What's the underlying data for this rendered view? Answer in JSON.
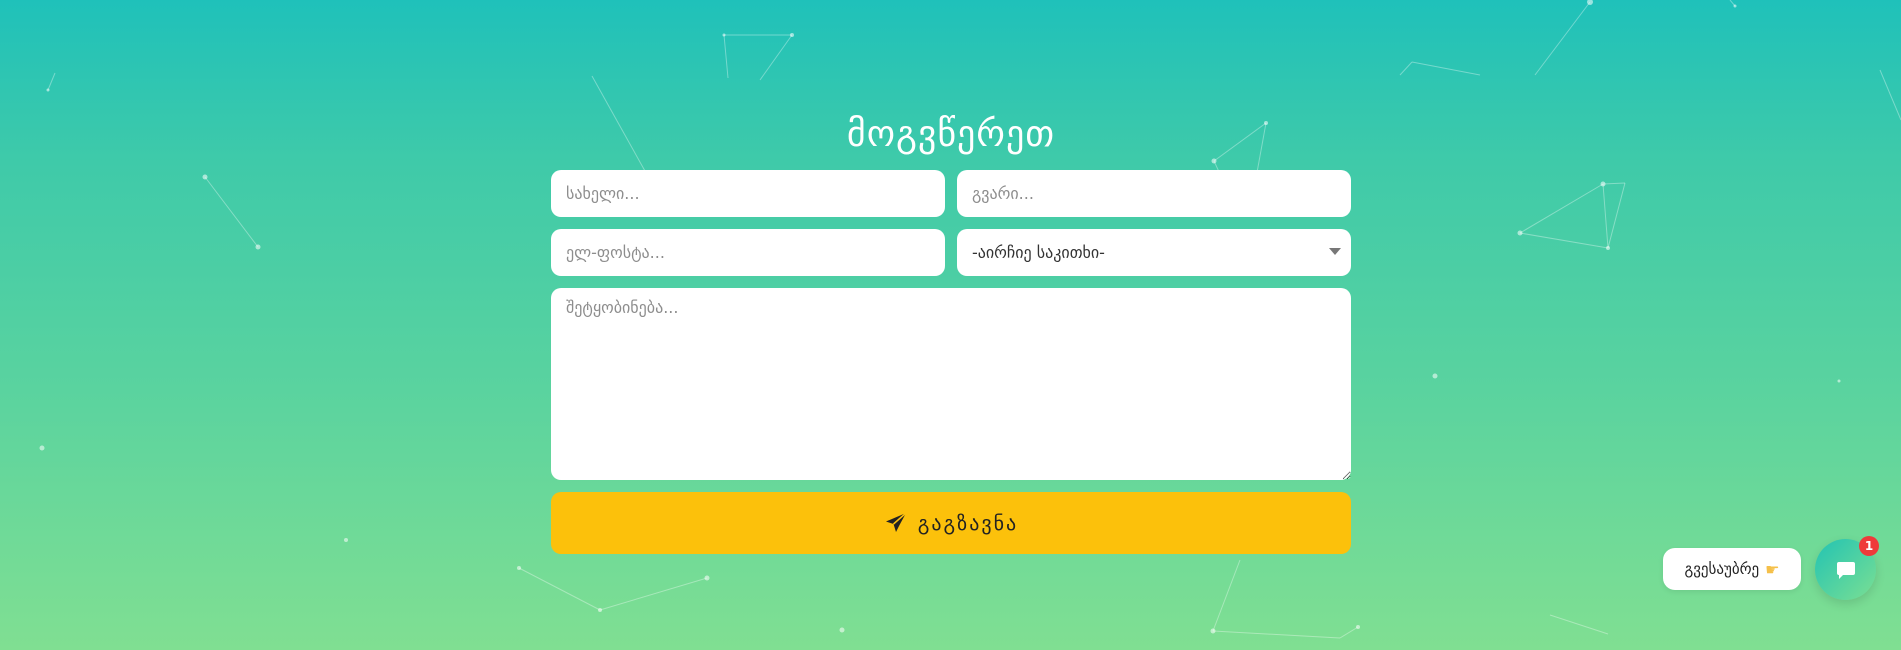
{
  "contact": {
    "title": "მოგვწერეთ",
    "first_name_placeholder": "სახელი...",
    "last_name_placeholder": "გვარი...",
    "email_placeholder": "ელ-ფოსტა...",
    "topic_selected": "-აირჩიე საკითხი-",
    "message_placeholder": "შეტყობინება...",
    "send_label": "გაგზავნა"
  },
  "chat": {
    "bubble_label": "გვესაუბრე",
    "badge_count": "1"
  },
  "icons": {
    "send": "paper-plane-icon",
    "hand": "pointing-hand-icon",
    "chat": "chat-bubble-icon",
    "select": "chevron-down-icon"
  },
  "colors": {
    "gradient_top": "#1fc1ba",
    "gradient_bottom": "#80df92",
    "send_button": "#fcc10b",
    "badge": "#ef3a3a"
  }
}
